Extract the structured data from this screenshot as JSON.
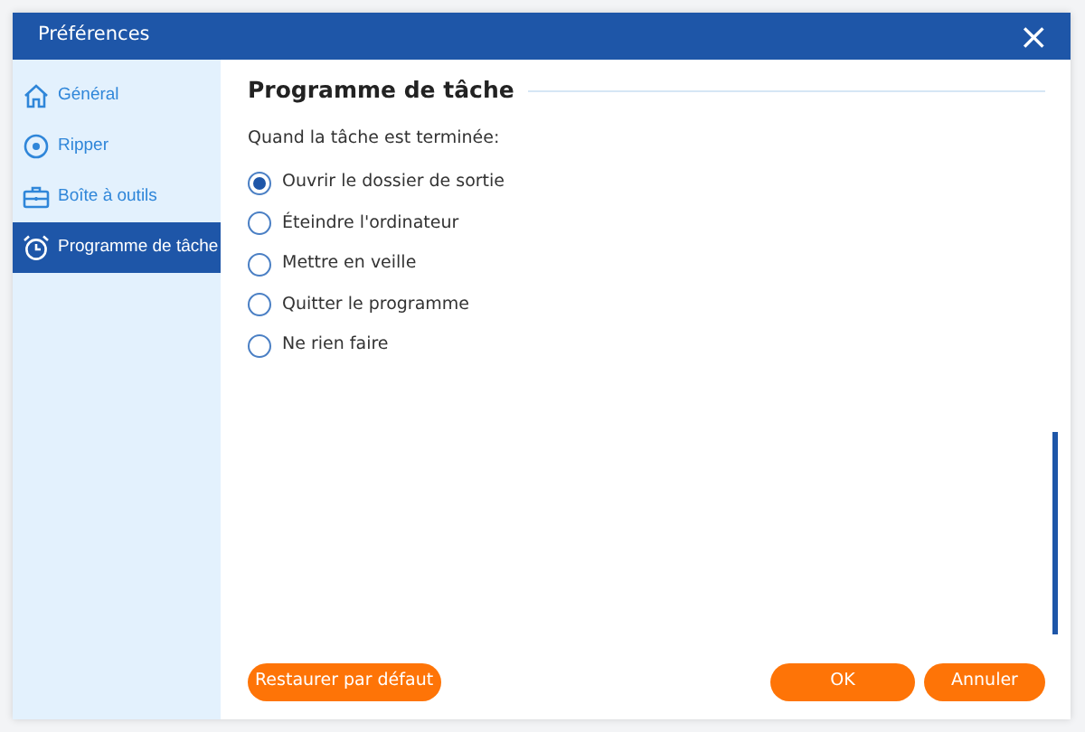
{
  "window": {
    "title": "Préférences",
    "close": "×"
  },
  "sidebar": {
    "items": [
      {
        "label": "Général",
        "selected": false
      },
      {
        "label": "Ripper",
        "selected": false
      },
      {
        "label": "Boîte à outils",
        "selected": false
      },
      {
        "label": "Programme de tâche",
        "selected": true
      }
    ]
  },
  "section": {
    "title": "Programme de tâche",
    "prompt": "Quand la tâche est terminée:",
    "options": [
      {
        "label": "Ouvrir le dossier de sortie",
        "selected": true
      },
      {
        "label": "Éteindre l'ordinateur",
        "selected": false
      },
      {
        "label": "Mettre en veille",
        "selected": false
      },
      {
        "label": "Quitter le programme",
        "selected": false
      },
      {
        "label": "Ne rien faire",
        "selected": false
      }
    ]
  },
  "buttons": {
    "restore": "Restaurer par défaut",
    "ok": "OK",
    "cancel": "Annuler"
  }
}
